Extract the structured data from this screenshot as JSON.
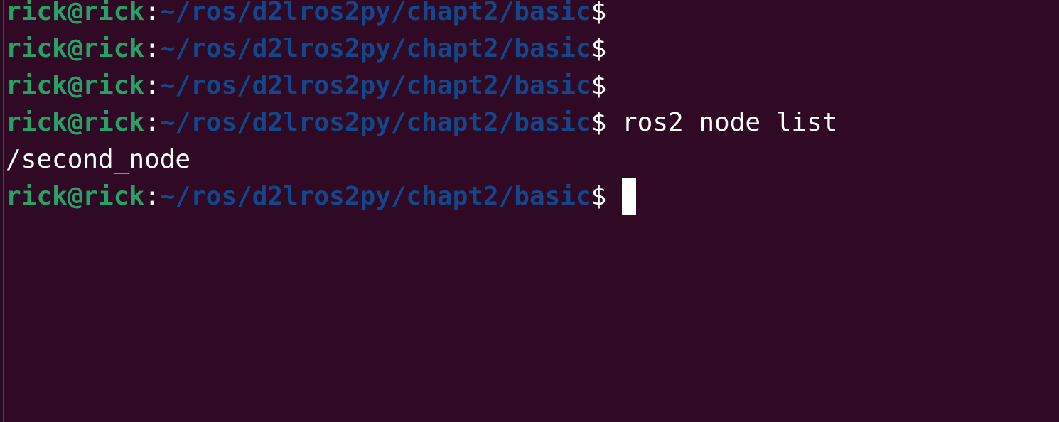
{
  "terminal": {
    "prompt": {
      "user_host": "rick@rick",
      "separator": ":",
      "path": "~/ros/d2lros2py/chapt2/basic",
      "symbol": "$"
    },
    "lines": [
      {
        "command": ""
      },
      {
        "command": ""
      },
      {
        "command": ""
      },
      {
        "command": " ros2 node list"
      }
    ],
    "output": "/second_node",
    "current_command": " ",
    "colors": {
      "background": "#300a24",
      "user": "#26a269",
      "path": "#12488b",
      "text": "#ffffff"
    }
  }
}
